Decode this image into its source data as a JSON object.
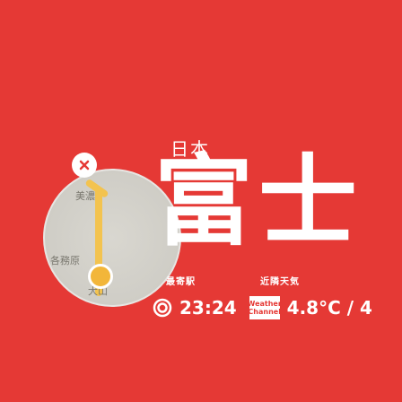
{
  "map": {
    "labels": [
      {
        "text": "美濃"
      },
      {
        "text": "各務原"
      },
      {
        "text": "犬山"
      }
    ]
  },
  "station": {
    "name_small": "日本",
    "name_large": "富士"
  },
  "labels": {
    "left": "最寄駅",
    "right": "近隣天気"
  },
  "status": {
    "time": "23:24",
    "channel_line1": "Weather",
    "channel_line2": "Channel",
    "temperature": "4.8°C / 4"
  },
  "icons": {
    "close": "close-icon",
    "clock": "clock-icon",
    "channel": "weather-channel-icon"
  },
  "colors": {
    "background": "#e53935",
    "map_road": "#f3c34f",
    "text": "#ffffff"
  }
}
